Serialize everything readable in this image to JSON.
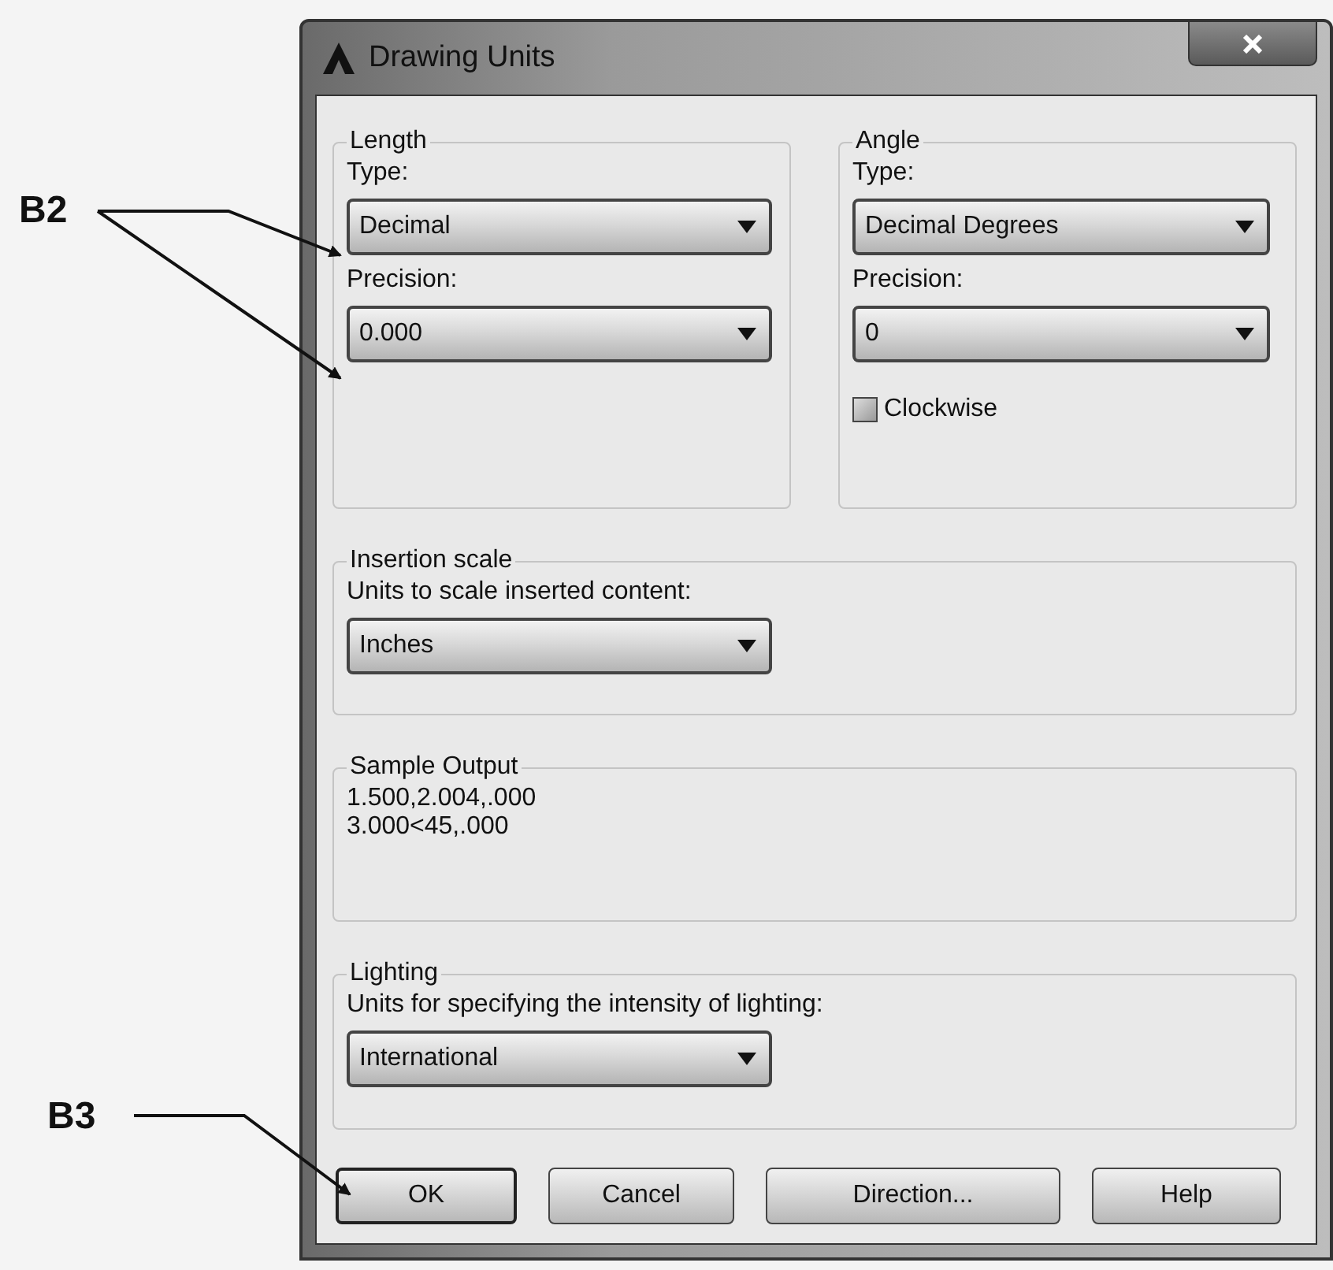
{
  "window": {
    "title": "Drawing Units"
  },
  "length": {
    "legend": "Length",
    "type_label": "Type:",
    "type_value": "Decimal",
    "precision_label": "Precision:",
    "precision_value": "0.000"
  },
  "angle": {
    "legend": "Angle",
    "type_label": "Type:",
    "type_value": "Decimal Degrees",
    "precision_label": "Precision:",
    "precision_value": "0",
    "clockwise": {
      "label": "Clockwise",
      "checked": false
    }
  },
  "insertion_scale": {
    "legend": "Insertion scale",
    "label": "Units to scale inserted content:",
    "value": "Inches"
  },
  "sample_output": {
    "legend": "Sample Output",
    "lines": [
      "1.500,2.004,.000",
      "3.000<45,.000"
    ]
  },
  "lighting": {
    "legend": "Lighting",
    "label": "Units for specifying the intensity of lighting:",
    "value": "International"
  },
  "buttons": [
    {
      "label": "OK",
      "focused": true
    },
    {
      "label": "Cancel",
      "focused": false
    },
    {
      "label": "Direction...",
      "focused": false
    },
    {
      "label": "Help",
      "focused": false
    }
  ],
  "annotations": [
    {
      "label": "B2"
    },
    {
      "label": "B3"
    }
  ]
}
